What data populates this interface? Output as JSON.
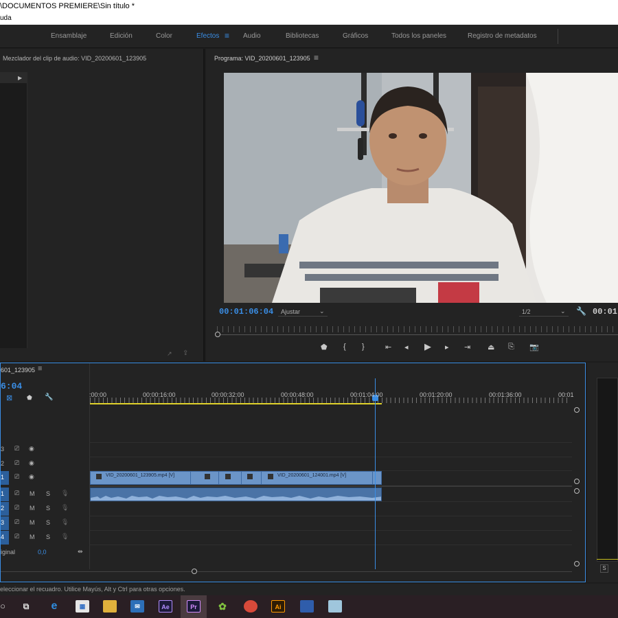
{
  "window": {
    "title": "\\DOCUMENTOS PREMIERE\\Sin título *",
    "menu_fragment": "uda"
  },
  "workspaces": {
    "items": [
      {
        "label": "Ensamblaje"
      },
      {
        "label": "Edición"
      },
      {
        "label": "Color"
      },
      {
        "label": "Efectos"
      },
      {
        "label": "Audio"
      },
      {
        "label": "Bibliotecas"
      },
      {
        "label": "Gráficos"
      },
      {
        "label": "Todos los paneles"
      },
      {
        "label": "Registro de metadatos"
      }
    ],
    "active": "Efectos",
    "menu_icon": "hamburger-icon"
  },
  "audio_mixer": {
    "title": "Mezclador del clip de audio: VID_20200601_123905"
  },
  "program_monitor": {
    "title": "Programa: VID_20200601_123905",
    "timecode": "00:01:06:04",
    "fit_label": "Ajustar",
    "resolution": "1/2",
    "end_timecode": "00:01:"
  },
  "timeline": {
    "sequence_name": "601_123905",
    "current_time": "6:04",
    "ruler_labels": [
      ":00:00",
      "00:00:16:00",
      "00:00:32:00",
      "00:00:48:00",
      "00:01:04:00",
      "00:01:20:00",
      "00:01:36:00",
      "00:01"
    ],
    "video_tracks": [
      {
        "label": "3"
      },
      {
        "label": "2"
      },
      {
        "label": "1"
      }
    ],
    "audio_tracks": [
      {
        "label": "1",
        "m": "M",
        "s": "S"
      },
      {
        "label": "2",
        "m": "M",
        "s": "S"
      },
      {
        "label": "3",
        "m": "M",
        "s": "S"
      },
      {
        "label": "4",
        "m": "M",
        "s": "S"
      }
    ],
    "master_label": "iginal",
    "master_value": "0,0",
    "clips": [
      {
        "name": "VID_20200601_123905.mp4 [V]"
      },
      {
        "name": "VID_20200601_124001.mp4 [V]"
      }
    ],
    "accent_color": "#3a8ee6",
    "clip_color": "#6b95c8"
  },
  "right_meter": {
    "label": "S"
  },
  "status": {
    "text": "eleccionar el recuadro. Utilice Mayús, Alt y Ctrl para otras opciones."
  },
  "taskbar": {
    "apps": [
      {
        "label": "Ae",
        "icon": "after-effects-icon"
      },
      {
        "label": "Pr",
        "icon": "premiere-icon"
      },
      {
        "label": "Ai",
        "icon": "illustrator-icon"
      }
    ]
  }
}
